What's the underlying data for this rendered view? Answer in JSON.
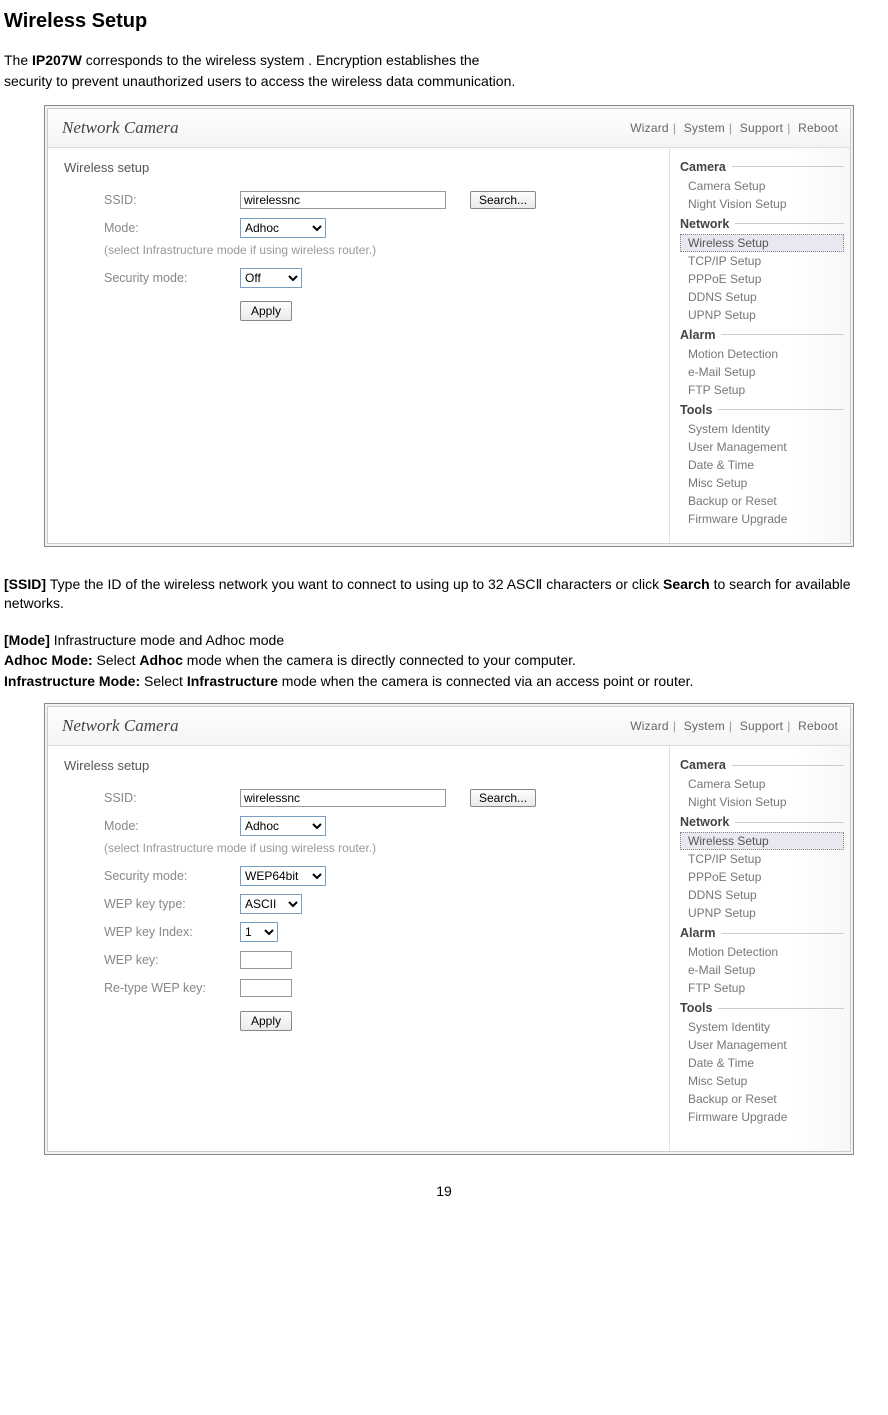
{
  "page": {
    "title": "Wireless Setup",
    "intro_line1_pre": "The ",
    "intro_line1_bold": "IP207W",
    "intro_line1_post": " corresponds to the wireless system . Encryption establishes the",
    "intro_line2": "security to prevent unauthorized users to access the wireless data communication.",
    "page_number": "19"
  },
  "shot": {
    "product_title": "Network Camera",
    "toplinks": {
      "wizard": "Wizard",
      "system": "System",
      "support": "Support",
      "reboot": "Reboot"
    },
    "panel_title": "Wireless setup",
    "labels": {
      "ssid": "SSID:",
      "mode": "Mode:",
      "hint": "(select Infrastructure mode if using wireless router.)",
      "security": "Security mode:",
      "wep_type": "WEP key type:",
      "wep_index": "WEP key Index:",
      "wep_key": "WEP key:",
      "wep_rekey": "Re-type WEP key:"
    },
    "values": {
      "ssid": "wirelessnc",
      "mode": "Adhoc",
      "security_off": "Off",
      "security_wep": "WEP64bit",
      "wep_type": "ASCII",
      "wep_index": "1"
    },
    "buttons": {
      "search": "Search...",
      "apply": "Apply"
    },
    "sidebar": {
      "groups": [
        {
          "title": "Camera",
          "items": [
            "Camera Setup",
            "Night Vision Setup"
          ]
        },
        {
          "title": "Network",
          "items": [
            "Wireless Setup",
            "TCP/IP Setup",
            "PPPoE Setup",
            "DDNS Setup",
            "UPNP Setup"
          ],
          "active_index": 0
        },
        {
          "title": "Alarm",
          "items": [
            "Motion Detection",
            "e-Mail Setup",
            "FTP Setup"
          ]
        },
        {
          "title": "Tools",
          "items": [
            "System Identity",
            "User Management",
            "Date & Time",
            "Misc Setup",
            "Backup or Reset",
            "Firmware Upgrade"
          ]
        }
      ]
    }
  },
  "desc": {
    "ssid_label": "[SSID] ",
    "ssid_text": "Type the ID of the wireless network you want to connect to using up to 32 ASCⅡ characters or click ",
    "ssid_bold2": "Search",
    "ssid_text2": " to search for available networks.",
    "mode_label": "[Mode] ",
    "mode_text": "Infrastructure mode and Adhoc mode",
    "adhoc_label": "Adhoc Mode: ",
    "adhoc_text1": "Select ",
    "adhoc_bold": "Adhoc",
    "adhoc_text2": " mode when the camera is directly connected to your computer.",
    "infra_label": "Infrastructure Mode: ",
    "infra_text1": "Select ",
    "infra_bold": "Infrastructure",
    "infra_text2": " mode when the camera is connected via an access point or router."
  }
}
